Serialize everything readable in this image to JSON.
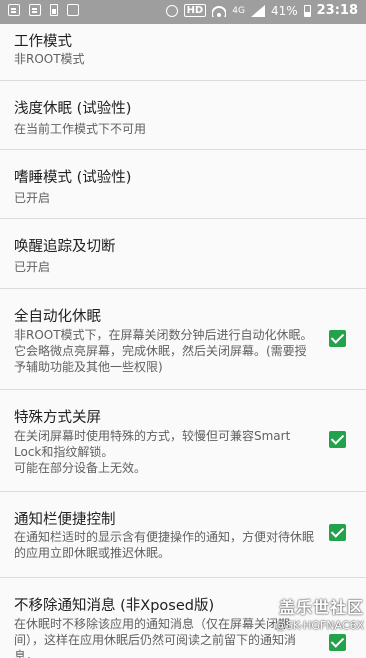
{
  "statusbar": {
    "hd": "HD",
    "net": "4G",
    "battery": "41%",
    "time": "23:18"
  },
  "items": [
    {
      "title": "工作模式",
      "summary": "非ROOT模式"
    },
    {
      "title": "浅度休眠 (试验性)",
      "summary": "在当前工作模式下不可用"
    },
    {
      "title": "嗜睡模式 (试验性)",
      "summary": "已开启"
    },
    {
      "title": "唤醒追踪及切断",
      "summary": "已开启"
    },
    {
      "title": "全自动化休眠",
      "summary": "非ROOT模式下，在屏幕关闭数分钟后进行自动化休眠。它会略微点亮屏幕，完成休眠，然后关闭屏幕。(需要授予辅助功能及其他一些权限)",
      "checked": true
    },
    {
      "title": "特殊方式关屏",
      "summary": "在关闭屏幕时使用特殊的方式，较慢但可兼容Smart Lock和指纹解锁。\n可能在部分设备上无效。",
      "checked": true
    },
    {
      "title": "通知栏便捷控制",
      "summary": "在通知栏适时的显示含有便捷操作的通知，方便对待休眠的应用立即休眠或推迟休眠。",
      "checked": true
    },
    {
      "title": "不移除通知消息 (非Xposed版)",
      "summary": "在休眠时不移除该应用的通知消息（仅在屏幕关闭期间），这样在应用休眠后仍然可阅读之前留下的通知消息，",
      "checked": true
    }
  ],
  "watermark": {
    "line1": "盖乐世社区",
    "line2": "@SK-HGFNAC6X"
  }
}
